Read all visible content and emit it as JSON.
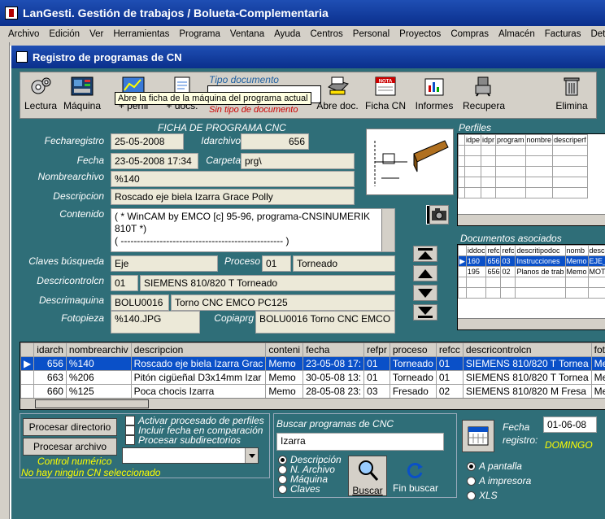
{
  "app": {
    "title": "LanGesti. Gestión de trabajos / Bolueta-Complementaria"
  },
  "menu": [
    "Archivo",
    "Edición",
    "Ver",
    "Herramientas",
    "Programa",
    "Ventana",
    "Ayuda",
    "Centros",
    "Personal",
    "Proyectos",
    "Compras",
    "Almacén",
    "Facturas",
    "Detalle Pptos"
  ],
  "window": {
    "title": "Registro de programas de CN"
  },
  "toolbar": {
    "lectura": "Lectura",
    "maquina": "Máquina",
    "perfil": "+ perfil",
    "docs": "+ docs.",
    "tipo_doc_label": "Tipo documento",
    "tipo_doc_value": "",
    "sin_tipo": "Sin tipo de documento",
    "abre_doc": "Abre doc.",
    "ficha_cn": "Ficha CN",
    "informes": "Informes",
    "recupera": "Recupera",
    "elimina": "Elimina",
    "nota_icon_text": "NOTA",
    "tooltip": "Abre la ficha de la máquina del programa actual"
  },
  "ficha": {
    "title": "FICHA DE PROGRAMA CNC",
    "fecharegistro_label": "Fecharegistro",
    "fecharegistro": "25-05-2008",
    "idarchivo_label": "Idarchivo",
    "idarchivo": "656",
    "fecha_label": "Fecha",
    "fecha": "23-05-2008 17:34",
    "carpeta_label": "Carpeta",
    "carpeta": "prg\\",
    "nombrearchivo_label": "Nombrearchivo",
    "nombrearchivo": "%140",
    "descripcion_label": "Descripcion",
    "descripcion": "Roscado eje biela Izarra Grace Polly",
    "contenido_label": "Contenido",
    "contenido": "( * WinCAM by EMCO [c] 95-96,  programa-CNSINUMERIK 810T        *)",
    "contenido_line2": "( -------------------------------------------------- )",
    "claves_label": "Claves búsqueda",
    "claves": "Eje",
    "proceso_label": "Proceso",
    "proceso_code": "01",
    "proceso": "Torneado",
    "descricontrol_label": "Descricontrolcn",
    "descricontrol_code": "01",
    "descricontrol": "SIEMENS 810/820 T Torneado",
    "descrimaquina_label": "Descrimaquina",
    "descrimaquina_code": "BOLU0016",
    "descrimaquina": "Torno CNC EMCO PC125",
    "fotopieza_label": "Fotopieza",
    "fotopieza": "%140.JPG",
    "copiaprg_label": "Copiaprg",
    "copiaprg": "BOLU0016 Torno CNC EMCO"
  },
  "perfiles": {
    "title": "Perfiles",
    "columns": [
      "idpe",
      "idpr",
      "program",
      "nombre",
      "descriperf"
    ]
  },
  "documentos": {
    "title": "Documentos asociados",
    "columns": [
      "iddoc",
      "refc",
      "refc",
      "descritipodoc",
      "nomb",
      "descr"
    ],
    "rows": [
      [
        "160",
        "656",
        "03",
        "Instrucciones",
        "Memo",
        "EJE_"
      ],
      [
        "195",
        "656",
        "02",
        "Planos de trab",
        "Memo",
        "MOTO"
      ]
    ]
  },
  "programas": {
    "columns": [
      "idarch",
      "nombrearchiv",
      "descripcion",
      "conteni",
      "fecha",
      "refpr",
      "proceso",
      "refcc",
      "descricontrolcn",
      "fotopi"
    ],
    "rows": [
      [
        "656",
        "%140",
        "Roscado eje biela Izarra Grac",
        "Memo",
        "23-05-08 17:",
        "01",
        "Torneado",
        "01",
        "SIEMENS 810/820 T Tornea",
        "Memo"
      ],
      [
        "663",
        "%206",
        "Pitón cigüeñal D3x14mm Izar",
        "Memo",
        "30-05-08 13:",
        "01",
        "Torneado",
        "01",
        "SIEMENS 810/820 T Tornea",
        "Memo"
      ],
      [
        "660",
        "%125",
        "Poca chocis Izarra",
        "Memo",
        "28-05-08 23:",
        "03",
        "Fresado",
        "02",
        "SIEMENS 810/820 M Fresa",
        "Memo"
      ]
    ]
  },
  "bottom": {
    "procesar_directorio": "Procesar directorio",
    "procesar_archivo": "Procesar archivo",
    "activar_perfiles": "Activar procesado de perfiles",
    "incluir_fecha": "Incluir fecha en comparación",
    "procesar_subdir": "Procesar subdirectorios",
    "control_numerico": "Control numérico",
    "no_cn": "No hay ningún CN seleccionado",
    "buscar_title": "Buscar programas de CNC",
    "buscar_value": "Izarra",
    "radio_options": [
      "Descripción",
      "N. Archivo",
      "Máquina",
      "Claves"
    ],
    "buscar": "Buscar",
    "fin_buscar": "Fin buscar",
    "fecha_registro_label1": "Fecha",
    "fecha_registro_label2": "registro:",
    "fecha_registro": "01-06-08",
    "dia": "DOMINGO",
    "output_options": [
      "A pantalla",
      "A impresora",
      "XLS"
    ]
  }
}
